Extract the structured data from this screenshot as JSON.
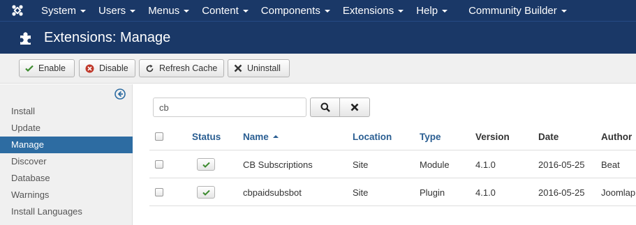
{
  "topnav": {
    "items": [
      {
        "label": "System"
      },
      {
        "label": "Users"
      },
      {
        "label": "Menus"
      },
      {
        "label": "Content"
      },
      {
        "label": "Components"
      },
      {
        "label": "Extensions"
      },
      {
        "label": "Help"
      },
      {
        "label": "Community Builder"
      }
    ]
  },
  "header": {
    "title": "Extensions: Manage"
  },
  "toolbar": {
    "enable": "Enable",
    "disable": "Disable",
    "refresh_cache": "Refresh Cache",
    "uninstall": "Uninstall"
  },
  "sidebar": {
    "items": [
      {
        "label": "Install"
      },
      {
        "label": "Update"
      },
      {
        "label": "Manage"
      },
      {
        "label": "Discover"
      },
      {
        "label": "Database"
      },
      {
        "label": "Warnings"
      },
      {
        "label": "Install Languages"
      }
    ],
    "active": "Manage"
  },
  "search": {
    "value": "cb"
  },
  "table": {
    "headers": {
      "status": "Status",
      "name": "Name",
      "location": "Location",
      "type": "Type",
      "version": "Version",
      "date": "Date",
      "author": "Author"
    },
    "rows": [
      {
        "name": "CB Subscriptions",
        "location": "Site",
        "type": "Module",
        "version": "4.1.0",
        "date": "2016-05-25",
        "author": "Beat"
      },
      {
        "name": "cbpaidsubsbot",
        "location": "Site",
        "type": "Plugin",
        "version": "4.1.0",
        "date": "2016-05-25",
        "author": "Joomlap"
      }
    ]
  },
  "colors": {
    "nav_bg": "#1a3867",
    "active_sidebar": "#2d6ca2",
    "link": "#2a5e92",
    "enabled_check": "#3c8a2e",
    "disable_icon": "#c0392b"
  }
}
